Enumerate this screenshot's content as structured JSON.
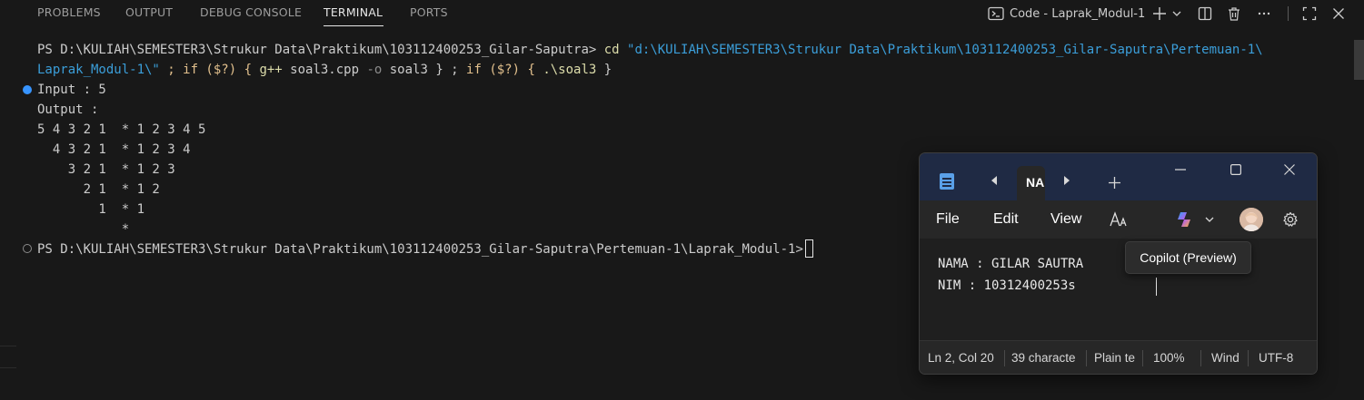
{
  "panel": {
    "tabs": [
      {
        "label": "PROBLEMS",
        "active": false
      },
      {
        "label": "OUTPUT",
        "active": false
      },
      {
        "label": "DEBUG CONSOLE",
        "active": false
      },
      {
        "label": "TERMINAL",
        "active": true
      },
      {
        "label": "PORTS",
        "active": false
      }
    ],
    "terminal_name": "Code - Laprak_Modul-1",
    "icons": [
      "terminal-icon",
      "plus-icon",
      "chevron-down-icon",
      "split-icon",
      "trash-icon",
      "more-icon",
      "maximize-icon",
      "close-icon"
    ]
  },
  "terminal": {
    "prompt1": "PS D:\\KULIAH\\SEMESTER3\\Strukur Data\\Praktikum\\103112400253_Gilar-Saputra>",
    "cmd_cd": "cd",
    "cmd_path_1": "\"d:\\KULIAH\\SEMESTER3\\Strukur Data\\Praktikum\\103112400253_Gilar-Saputra\\Pertemuan-1\\",
    "cmd_path_2": "Laprak_Modul-1\\\"",
    "cmd_rest_1": " ; if ($?) { ",
    "cmd_gpp": "g++",
    "cmd_file": " soal3.cpp ",
    "cmd_flag": "-o",
    "cmd_out": " soal3 } ; ",
    "cmd_if2": "if ($?) { ",
    "cmd_run": ".\\soal3",
    "cmd_end": " }",
    "output_lines": [
      "Input : 5",
      "Output :",
      "5 4 3 2 1  * 1 2 3 4 5",
      "  4 3 2 1  * 1 2 3 4",
      "    3 2 1  * 1 2 3",
      "      2 1  * 1 2",
      "        1  * 1",
      "           *"
    ],
    "prompt2": "PS D:\\KULIAH\\SEMESTER3\\Strukur Data\\Praktikum\\103112400253_Gilar-Saputra\\Pertemuan-1\\Laprak_Modul-1>"
  },
  "notepad": {
    "tab_title": "NA",
    "menu": [
      "File",
      "Edit",
      "View"
    ],
    "content": [
      "NAMA : GILAR SAUTRA",
      "NIM : 10312400253s"
    ],
    "status": {
      "position": "Ln 2, Col 20",
      "chars": "39 characte",
      "format": "Plain te",
      "zoom": "100%",
      "line_ending": "Wind",
      "encoding": "UTF-8"
    },
    "icons": [
      "notepad-app-icon",
      "chevron-left-icon",
      "chevron-right-icon",
      "add-tab-icon",
      "minimize-icon",
      "maximize-icon",
      "close-icon",
      "text-format-icon",
      "copilot-icon",
      "profile-avatar",
      "settings-gear-icon"
    ]
  },
  "tooltip": "Copilot (Preview)",
  "colors": {
    "terminal_bg": "#181818",
    "prompt_decoration": "#3794ff",
    "string_blue": "#3b9ed9",
    "command_yellow": "#dcdcaa",
    "notepad_titlebar": "#1f2a44"
  }
}
